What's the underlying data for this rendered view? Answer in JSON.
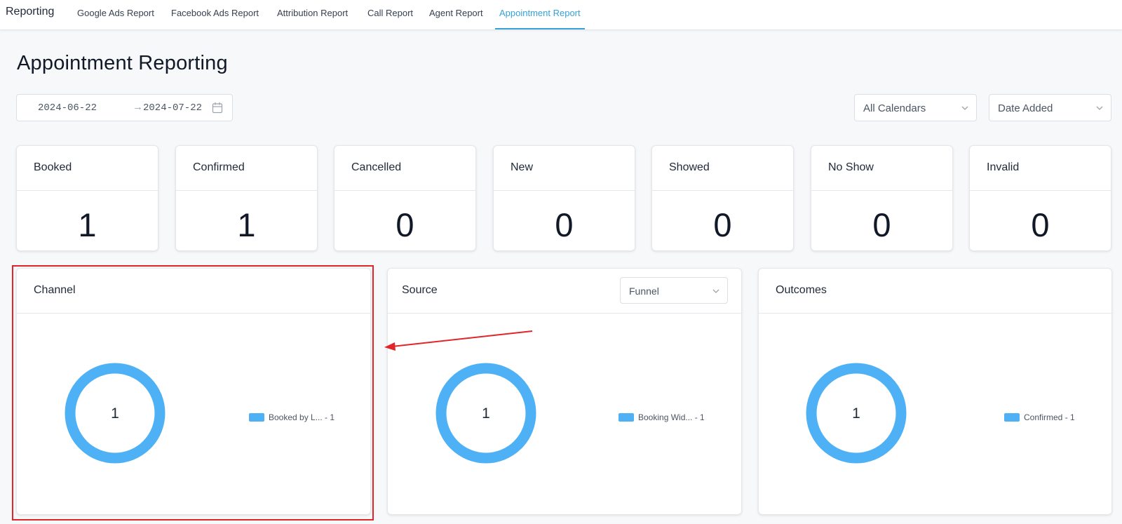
{
  "nav": {
    "brand": "Reporting",
    "tabs": [
      {
        "label": "Google Ads Report",
        "active": false
      },
      {
        "label": "Facebook Ads Report",
        "active": false
      },
      {
        "label": "Attribution Report",
        "active": false
      },
      {
        "label": "Call Report",
        "active": false
      },
      {
        "label": "Agent Report",
        "active": false
      },
      {
        "label": "Appointment Report",
        "active": true
      }
    ]
  },
  "page": {
    "title": "Appointment Reporting"
  },
  "filters": {
    "date_start": "2024-06-22",
    "date_end": "2024-07-22",
    "arrow_icon": "arrow-right-icon",
    "calendar_icon": "calendar-icon",
    "calendar_select": "All Calendars",
    "date_type_select": "Date Added"
  },
  "stats": [
    {
      "label": "Booked",
      "value": "1"
    },
    {
      "label": "Confirmed",
      "value": "1"
    },
    {
      "label": "Cancelled",
      "value": "0"
    },
    {
      "label": "New",
      "value": "0"
    },
    {
      "label": "Showed",
      "value": "0"
    },
    {
      "label": "No Show",
      "value": "0"
    },
    {
      "label": "Invalid",
      "value": "0"
    }
  ],
  "panels": {
    "channel": {
      "title": "Channel",
      "total": "1",
      "legend": "Booked by L... - 1"
    },
    "source": {
      "title": "Source",
      "select": "Funnel",
      "total": "1",
      "legend": "Booking Wid... - 1"
    },
    "outcomes": {
      "title": "Outcomes",
      "total": "1",
      "legend": "Confirmed - 1"
    }
  },
  "colors": {
    "accent": "#35a2d8",
    "donut": "#4fb1f5",
    "annotation": "#e0262b"
  }
}
